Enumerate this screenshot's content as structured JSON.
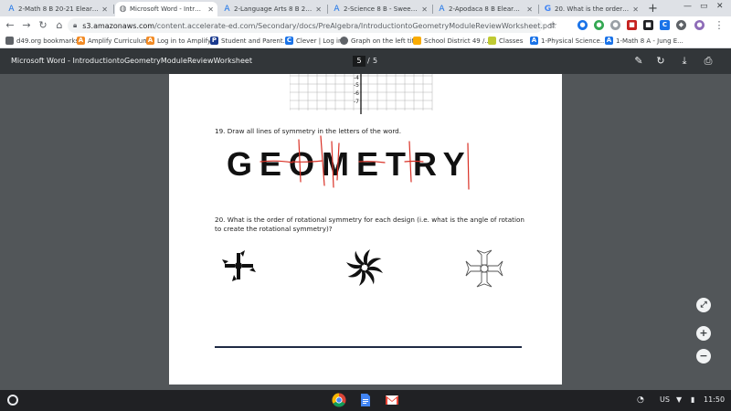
{
  "browser": {
    "tabs": [
      {
        "label": "2-Math 8 B 20-21 Elearning",
        "icon": "accelerate-icon",
        "active": false
      },
      {
        "label": "Microsoft Word - Introductio",
        "icon": "globe-icon",
        "active": true
      },
      {
        "label": "2-Language Arts 8 B 20-21 E",
        "icon": "accelerate-icon",
        "active": false
      },
      {
        "label": "2-Science 8 B - Sweeney ELea",
        "icon": "accelerate-icon",
        "active": false
      },
      {
        "label": "2-Apodaca 8 B Elearning Soc",
        "icon": "accelerate-icon",
        "active": false
      },
      {
        "label": "20. What is the order of rota",
        "icon": "google-icon",
        "active": false
      }
    ],
    "new_tab": "+",
    "url_host": "s3.amazonaws.com",
    "url_path": "/content.accelerate-ed.com/Secondary/docs/PreAlgebra/IntroductiontoGeometryModuleReviewWorksheet.pdf",
    "bookmarks": [
      {
        "label": "d49.org bookmarks",
        "icon": "folder-icon"
      },
      {
        "label": "Amplify Curriculum",
        "icon": "amplify-icon"
      },
      {
        "label": "Log in to Amplify",
        "icon": "amplify-icon"
      },
      {
        "label": "Student and Parent...",
        "icon": "p-icon"
      },
      {
        "label": "Clever | Log in",
        "icon": "clever-icon"
      },
      {
        "label": "Graph on the left tit...",
        "icon": "globe-icon"
      },
      {
        "label": "School District 49 /...",
        "icon": "district-icon"
      },
      {
        "label": "Classes",
        "icon": "classes-icon"
      },
      {
        "label": "1-Physical Science...",
        "icon": "accelerate-icon"
      },
      {
        "label": "1-Math 8 A - Jung E...",
        "icon": "accelerate-icon"
      }
    ]
  },
  "pdf": {
    "title": "Microsoft Word - IntroductiontoGeometryModuleReviewWorksheet",
    "current_page": "5",
    "separator": "/",
    "total_pages": "5",
    "axis_labels": [
      "-4",
      "-5",
      "-6",
      "-7"
    ],
    "q19": "19. Draw all lines of symmetry in the letters of the word.",
    "word": "GEOMETRY",
    "q20": "20. What is the order of rotational symmetry for each design (i.e. what is the angle of rotation to create the rotational symmetry)?"
  },
  "taskbar": {
    "locale": "US",
    "time": "11:50"
  },
  "colors": {
    "pdf_toolbar": "#323639",
    "viewer_bg": "#525659",
    "symmetry_lines": "#d93025",
    "taskbar": "#202124"
  }
}
